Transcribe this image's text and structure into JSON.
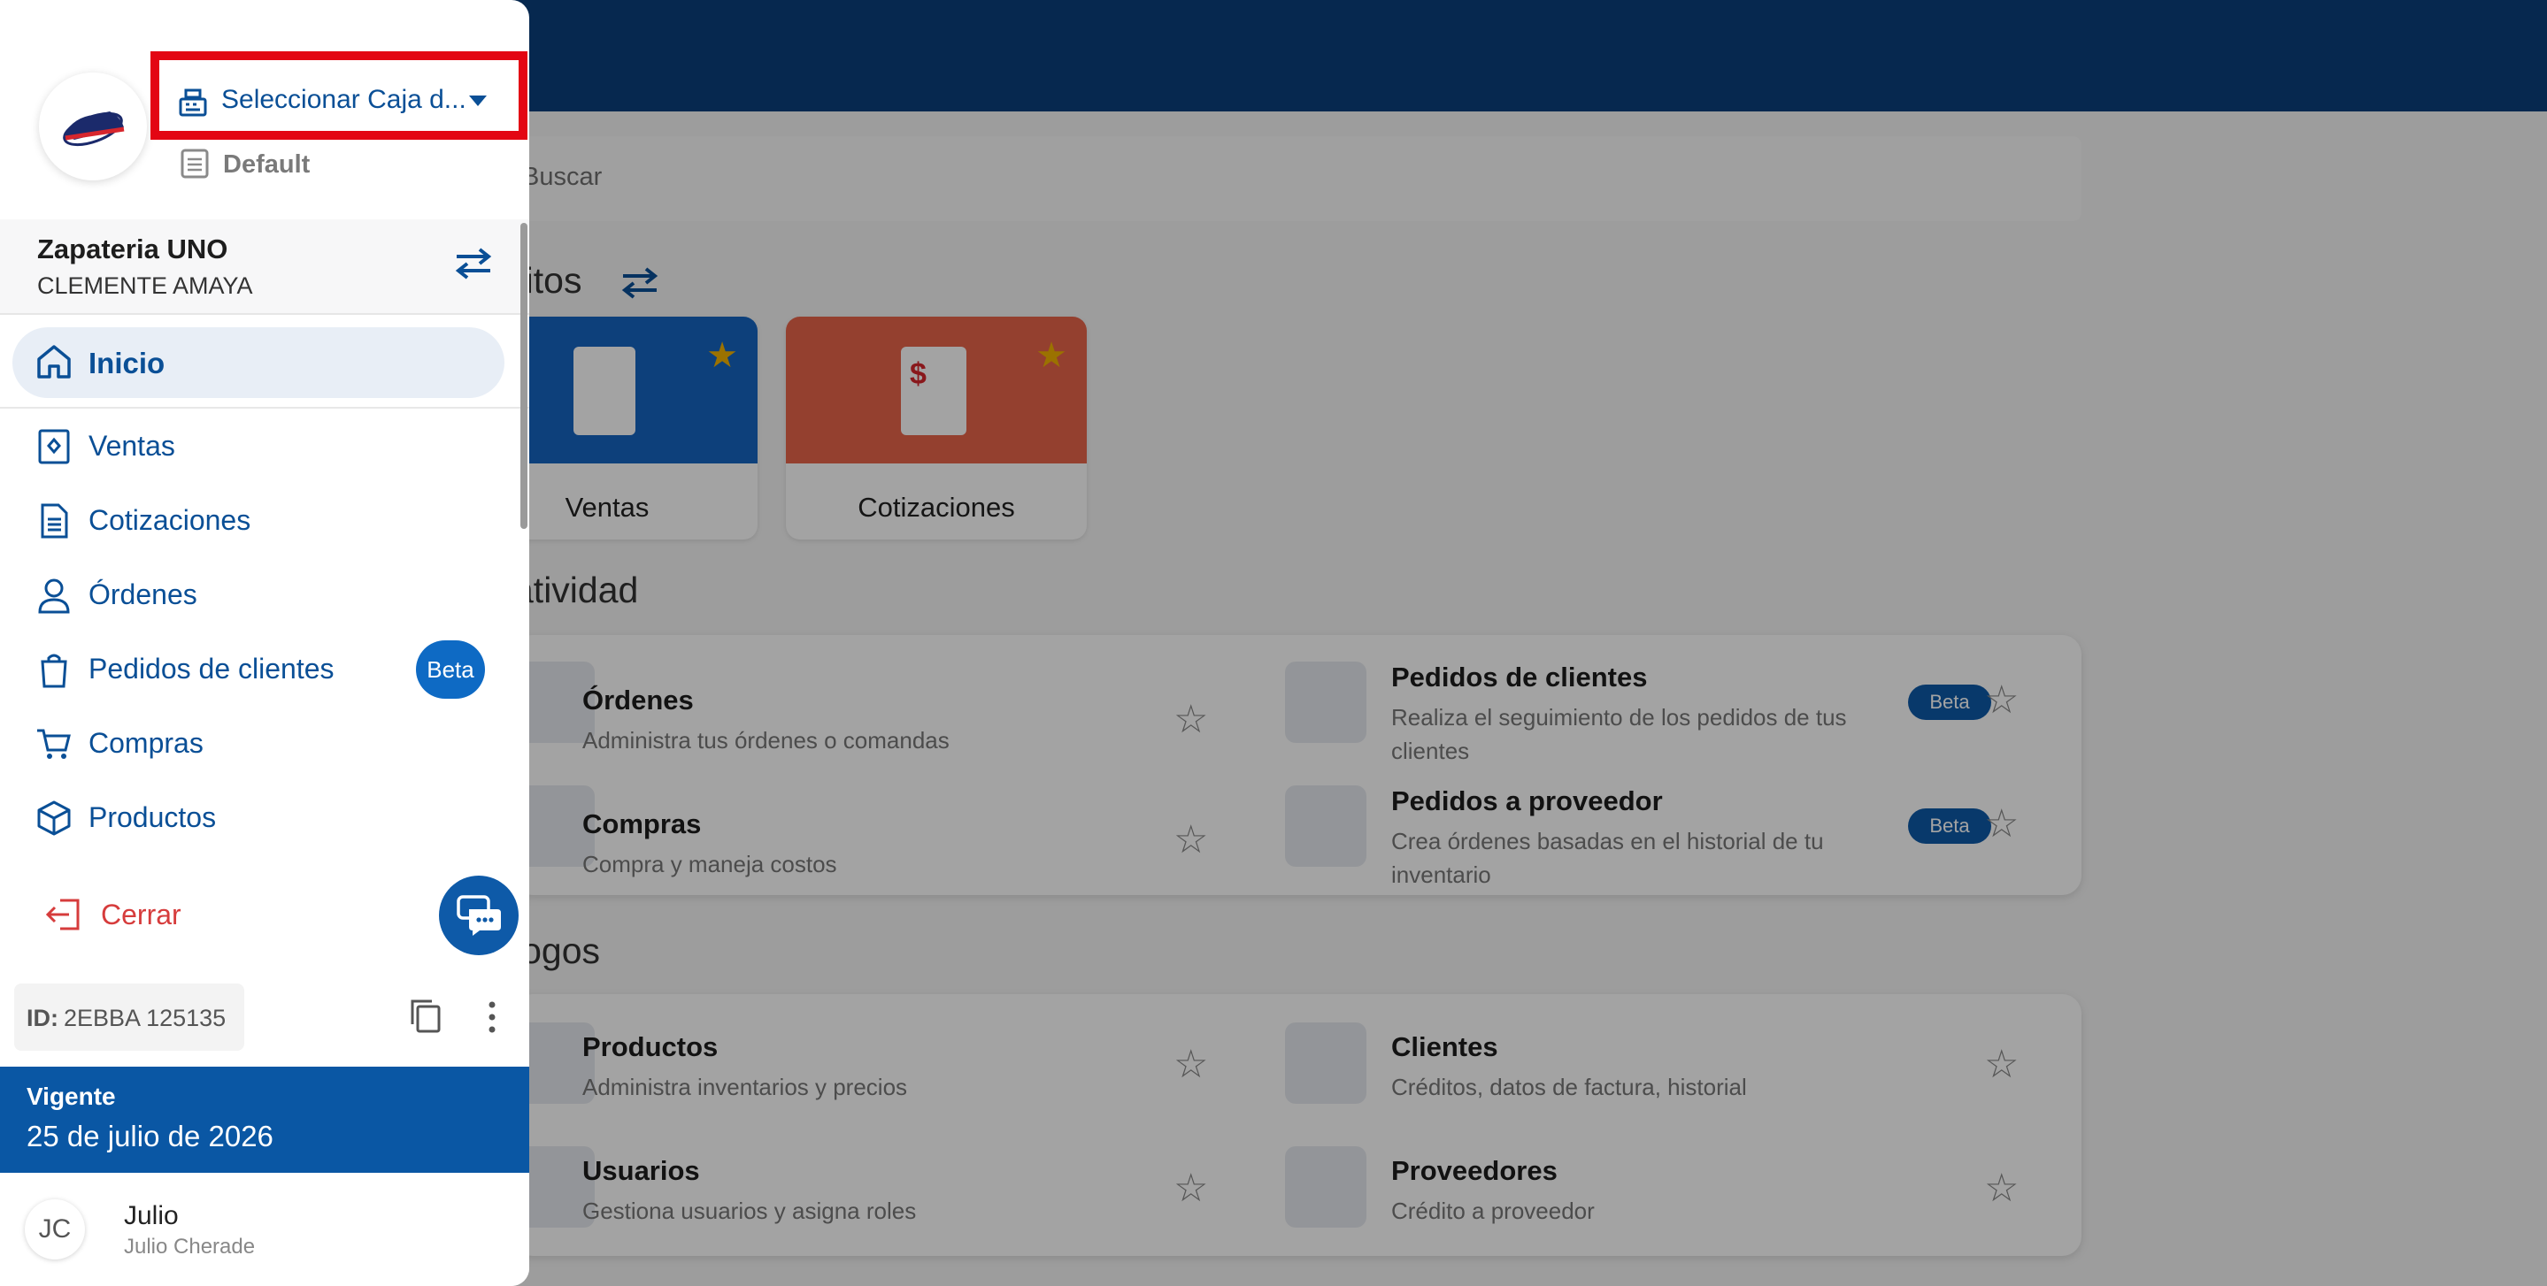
{
  "main": {
    "search_placeholder": "Buscar",
    "favorites_title": "ritos",
    "productivity_title": "atividad",
    "catalogs_title": "logos",
    "favorites": [
      {
        "label": "Ventas",
        "color": "#1565c0"
      },
      {
        "label": "Cotizaciones",
        "color": "#e8644a"
      }
    ],
    "productivity": [
      {
        "title": "Órdenes",
        "subtitle": "Administra tus órdenes o comandas"
      },
      {
        "title": "Pedidos de clientes",
        "subtitle": "Realiza el seguimiento de los pedidos de tus clientes",
        "badge": "Beta"
      },
      {
        "title": "Compras",
        "subtitle": "Compra y maneja costos"
      },
      {
        "title": "Pedidos a proveedor",
        "subtitle": "Crea órdenes basadas en el historial de tu inventario",
        "badge": "Beta"
      }
    ],
    "catalogs": [
      {
        "title": "Productos",
        "subtitle": "Administra inventarios y precios"
      },
      {
        "title": "Clientes",
        "subtitle": "Créditos, datos de factura, historial"
      },
      {
        "title": "Usuarios",
        "subtitle": "Gestiona usuarios y asigna roles"
      },
      {
        "title": "Proveedores",
        "subtitle": "Crédito a proveedor"
      }
    ]
  },
  "drawer": {
    "caja_selector": "Seleccionar Caja d...",
    "warehouse": "Default",
    "business_name": "Zapateria UNO",
    "business_user": "CLEMENTE AMAYA",
    "active_item": "Inicio",
    "nav": [
      {
        "label": "Ventas",
        "icon": "receipt-icon"
      },
      {
        "label": "Cotizaciones",
        "icon": "document-icon"
      },
      {
        "label": "Órdenes",
        "icon": "waiter-icon"
      },
      {
        "label": "Pedidos de clientes",
        "icon": "bag-icon",
        "badge": "Beta"
      },
      {
        "label": "Compras",
        "icon": "cart-icon"
      },
      {
        "label": "Productos",
        "icon": "box-icon"
      }
    ],
    "logout": "Cerrar",
    "id_label": "ID:",
    "id_value": "2EBBA 125135",
    "status_label": "Vigente",
    "status_date": "25 de julio de 2026",
    "user_initials": "JC",
    "user_name": "Julio",
    "user_fullname": "Julio Cherade"
  },
  "colors": {
    "brand": "#0a4f96",
    "topbar": "#0a3f7c",
    "highlight": "#e30613",
    "danger": "#d63c3c"
  }
}
